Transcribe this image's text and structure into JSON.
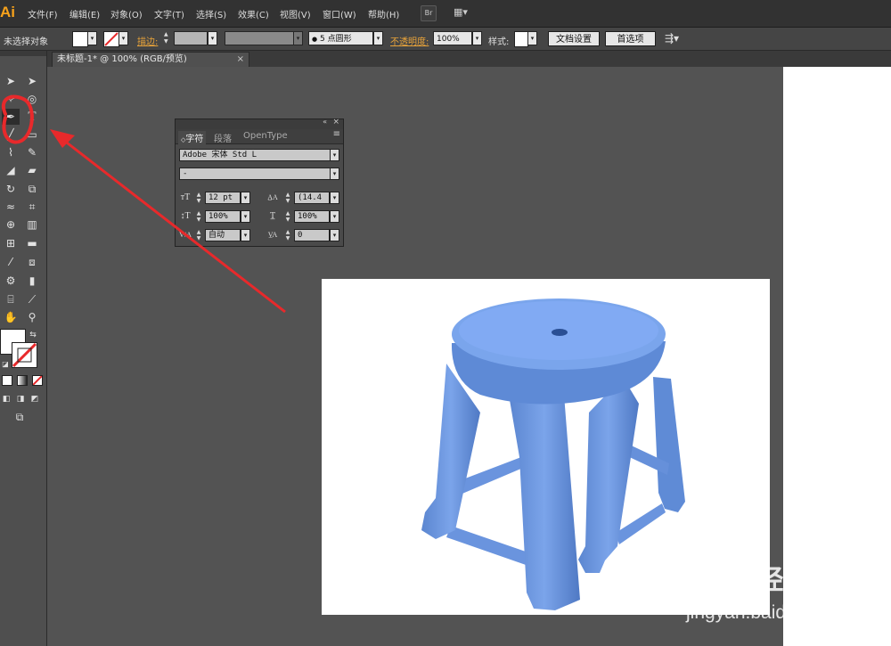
{
  "app": {
    "logo": "Ai",
    "brand_color": "#f7a21b"
  },
  "menu": [
    "文件(F)",
    "编辑(E)",
    "对象(O)",
    "文字(T)",
    "选择(S)",
    "效果(C)",
    "视图(V)",
    "窗口(W)",
    "帮助(H)"
  ],
  "menubar_buttons": {
    "bridge": "Br",
    "arrange": "▦▾"
  },
  "control_bar": {
    "selection_status": "未选择对象",
    "stroke_label": "描边:",
    "brush_value": "5 点圆形",
    "opacity_label": "不透明度:",
    "opacity_value": "100%",
    "style_label": "样式:",
    "doc_setup_button": "文档设置",
    "preferences_button": "首选项"
  },
  "document_tab": {
    "title": "未标题-1* @ 100% (RGB/预览)",
    "close": "×"
  },
  "character_panel": {
    "tabs": [
      "字符",
      "段落",
      "OpenType"
    ],
    "font_family": "Adobe 宋体 Std L",
    "font_style": "-",
    "font_size": "12 pt",
    "leading": "(14.4",
    "vertical_scale": "100%",
    "horizontal_scale": "100%",
    "kerning": "自动",
    "tracking": "0"
  },
  "watermark": {
    "brand": "Baidu经验",
    "url": "jingyan.baidu.com"
  },
  "colors": {
    "annotation_red": "#e8292b",
    "stool_blue": "#6c98e0",
    "canvas_gray": "#535353"
  }
}
